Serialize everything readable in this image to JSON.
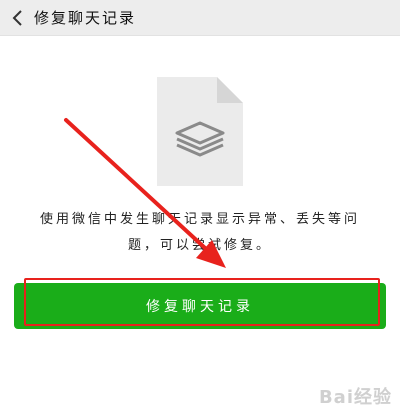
{
  "header": {
    "title": "修复聊天记录",
    "back_icon": "chevron-left-icon"
  },
  "content": {
    "file_icon": "stacked-layers-file-icon",
    "description_line1": "使用微信中发生聊天记录显示异常、丢失等问",
    "description_line2": "题，可以尝试修复。"
  },
  "action": {
    "button_label": "修复聊天记录"
  },
  "annotation": {
    "color": "#e8221d"
  },
  "watermark": {
    "text": "Bai经验"
  },
  "colors": {
    "header_bg": "#ededed",
    "button_bg": "#1aad19",
    "button_text": "#ffffff"
  }
}
